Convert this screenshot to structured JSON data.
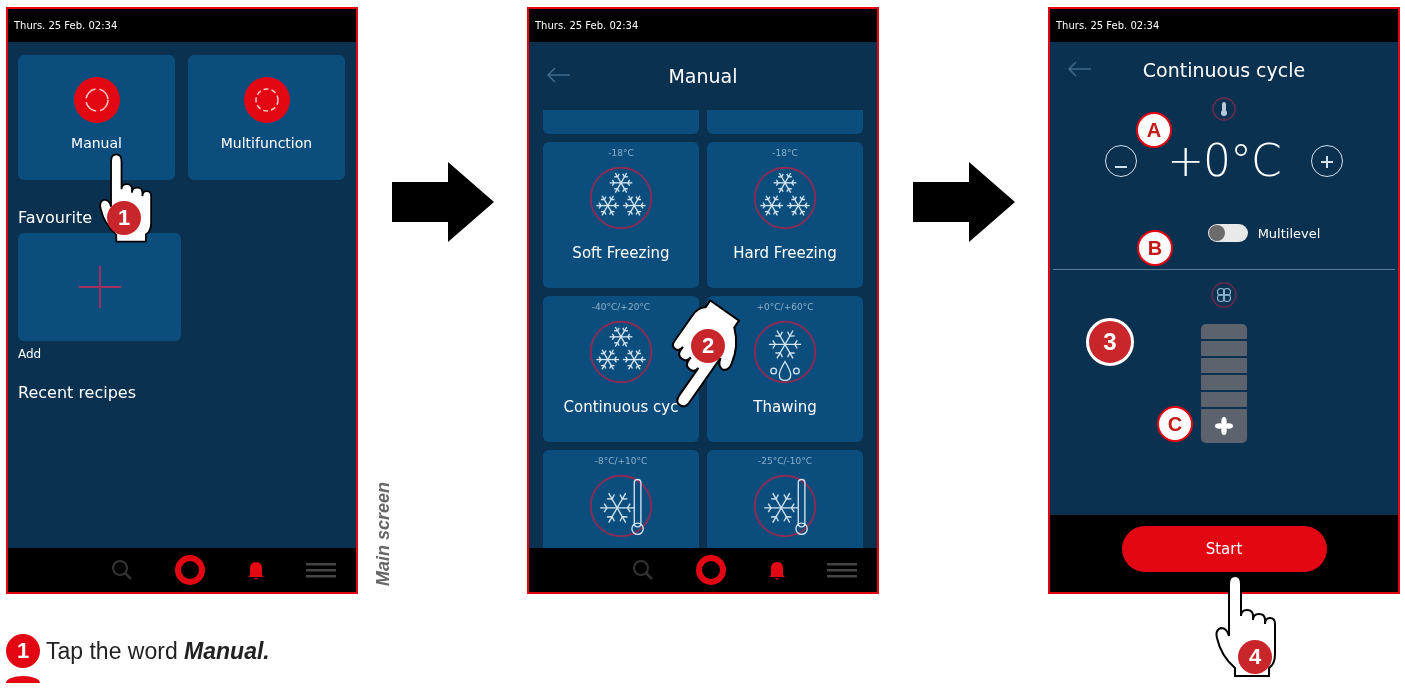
{
  "screens": [
    {
      "kind": "home",
      "status_time": "Thurs. 25 Feb. 02:34",
      "tiles": [
        {
          "label": "Manual"
        },
        {
          "label": "Multifunction"
        }
      ],
      "favourites_heading": "Favourite",
      "add_label": "Add",
      "recent_heading": "Recent recipes",
      "step": "1"
    },
    {
      "kind": "programs",
      "status_time": "Thurs. 25 Feb. 02:34",
      "title": "Manual",
      "programs": [
        {
          "kind": "three-flakes",
          "temperature": "-18°C",
          "label": "Soft Freezing"
        },
        {
          "kind": "three-flakes",
          "temperature": "-18°C",
          "label": "Hard Freezing"
        },
        {
          "kind": "three-flakes",
          "temperature": "-40°C/+20°C",
          "label": "Continuous cyc"
        },
        {
          "kind": "flake-drop",
          "temperature": "+0°C/+60°C",
          "label": "Thawing"
        },
        {
          "kind": "flake-thermo",
          "temperature": "-8°C/+10°C"
        },
        {
          "kind": "flake-thermo",
          "temperature": "-25°C/-10°C"
        }
      ],
      "step": "2"
    },
    {
      "kind": "cycle",
      "status_time": "Thurs. 25 Feb. 02:34",
      "title": "Continuous cycle",
      "temperature": "+0°C",
      "multilevel": {
        "label": "Multilevel",
        "on": false
      },
      "callouts": [
        "A",
        "B",
        "C"
      ],
      "section_step": "3",
      "start_label": "Start",
      "step": "4"
    }
  ],
  "side_label": "Main screen",
  "instructions": [
    {
      "number": "1",
      "text": "Tap the word **Manual.**"
    }
  ]
}
